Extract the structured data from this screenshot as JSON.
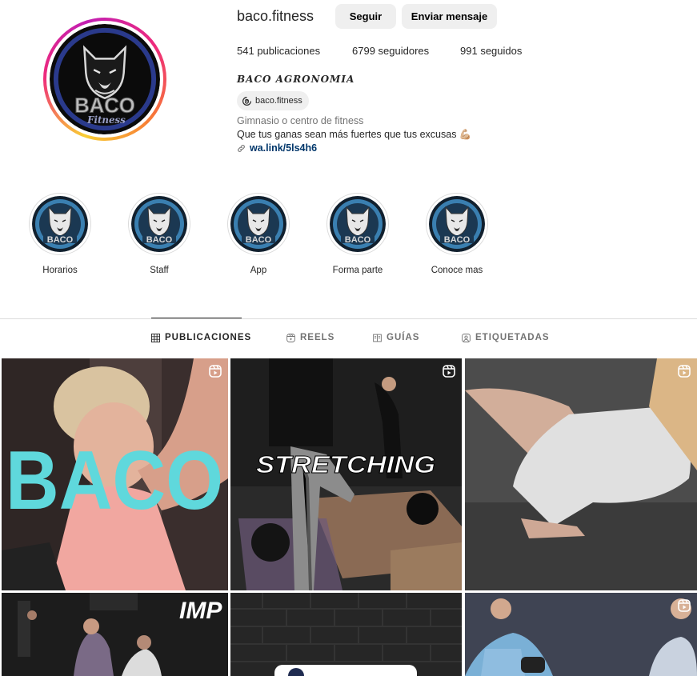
{
  "profile": {
    "username": "baco.fitness",
    "follow_label": "Seguir",
    "message_label": "Enviar mensaje",
    "stats": {
      "posts": "541",
      "posts_label": "publicaciones",
      "followers": "6799",
      "followers_label": "seguidores",
      "following": "991",
      "following_label": "seguidos"
    },
    "full_name": "BACO AGRONOMIA",
    "threads_handle": "baco.fitness",
    "category": "Gimnasio o centro de fitness",
    "bio": "Que tus ganas sean más fuertes que tus excusas 💪🏼",
    "link": "wa.link/5ls4h6",
    "logo_text": "BACO",
    "logo_subtext": "Fitness"
  },
  "highlights": [
    {
      "label": "Horarios"
    },
    {
      "label": "Staff"
    },
    {
      "label": "App"
    },
    {
      "label": "Forma parte"
    },
    {
      "label": "Conoce mas"
    }
  ],
  "tabs": [
    {
      "label": "PUBLICACIONES",
      "icon": "grid-icon",
      "active": true
    },
    {
      "label": "REELS",
      "icon": "reels-icon",
      "active": false
    },
    {
      "label": "GUÍAS",
      "icon": "guides-icon",
      "active": false
    },
    {
      "label": "ETIQUETADAS",
      "icon": "tagged-icon",
      "active": false
    }
  ],
  "posts": [
    {
      "overlay_text": "BACO",
      "reel": true
    },
    {
      "overlay_text": "STRETCHING",
      "reel": true
    },
    {
      "overlay_text": "",
      "reel": true
    },
    {
      "overlay_text": "IMP",
      "reel": false
    },
    {
      "overlay_text": "",
      "reel": false
    },
    {
      "overlay_text": "",
      "reel": true
    }
  ],
  "colors": {
    "button_bg": "#efefef",
    "link": "#00376b",
    "muted": "#737373",
    "accent_cyan": "#5fd8dc"
  }
}
